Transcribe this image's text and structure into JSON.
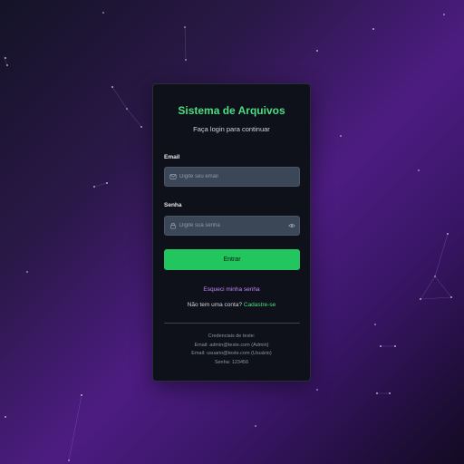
{
  "login": {
    "title": "Sistema de Arquivos",
    "subtitle": "Faça login para continuar",
    "email_label": "Email",
    "email_placeholder": "Digite seu email",
    "email_value": "",
    "password_label": "Senha",
    "password_placeholder": "Digite sua senha",
    "password_value": "",
    "submit_label": "Entrar",
    "forgot_link": "Esqueci minha senha",
    "no_account_text": "Não tem uma conta?",
    "signup_link": "Cadastre-se"
  },
  "test_credentials": {
    "heading": "Credenciais de teste:",
    "line1": "Email: admin@teste.com (Admin)",
    "line2": "Email: usuario@teste.com (Usuário)",
    "line3": "Senha: 123456"
  },
  "icons": {
    "email_field": "mail-icon",
    "password_field": "lock-icon",
    "password_toggle": "eye-icon"
  },
  "colors": {
    "accent_green": "#4ade80",
    "button_green": "#22c55e",
    "link_purple": "#c084fc",
    "card_bg": "#0f111a",
    "field_bg": "#3b4656"
  }
}
